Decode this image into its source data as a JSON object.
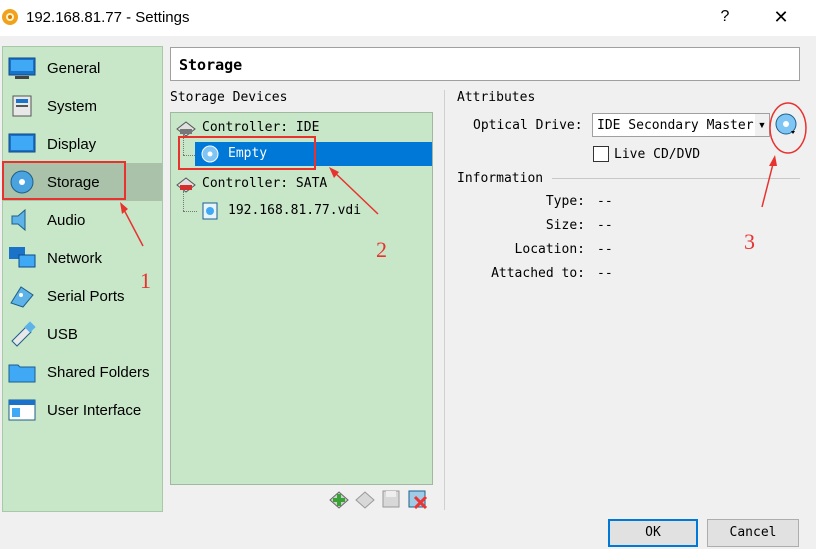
{
  "window": {
    "title": "192.168.81.77 - Settings",
    "help_glyph": "?",
    "close_glyph": "✕"
  },
  "sidebar": {
    "items": [
      {
        "label": "General",
        "icon": "general-icon"
      },
      {
        "label": "System",
        "icon": "system-icon"
      },
      {
        "label": "Display",
        "icon": "display-icon"
      },
      {
        "label": "Storage",
        "icon": "storage-icon",
        "selected": true
      },
      {
        "label": "Audio",
        "icon": "audio-icon"
      },
      {
        "label": "Network",
        "icon": "network-icon"
      },
      {
        "label": "Serial Ports",
        "icon": "serial-ports-icon"
      },
      {
        "label": "USB",
        "icon": "usb-icon"
      },
      {
        "label": "Shared Folders",
        "icon": "shared-folders-icon"
      },
      {
        "label": "User Interface",
        "icon": "user-interface-icon"
      }
    ]
  },
  "page": {
    "heading": "Storage"
  },
  "storage_devices": {
    "label": "Storage Devices",
    "tree": [
      {
        "label": "Controller: IDE",
        "type": "controller"
      },
      {
        "label": "Empty",
        "type": "optical",
        "selected": true
      },
      {
        "label": "Controller: SATA",
        "type": "controller"
      },
      {
        "label": "192.168.81.77.vdi",
        "type": "disk"
      }
    ],
    "toolbar": [
      "add-attachment-icon",
      "remove-controller-icon",
      "floppy-icon",
      "remove-attachment-icon"
    ]
  },
  "attributes": {
    "label": "Attributes",
    "optical_drive_label": "Optical Drive:",
    "optical_drive_value": "IDE Secondary Master",
    "live_cd_label": "Live CD/DVD",
    "live_cd_checked": false
  },
  "information": {
    "label": "Information",
    "rows": [
      {
        "key": "Type:",
        "value": "--"
      },
      {
        "key": "Size:",
        "value": "--"
      },
      {
        "key": "Location:",
        "value": "--"
      },
      {
        "key": "Attached to:",
        "value": "--"
      }
    ]
  },
  "buttons": {
    "ok": "OK",
    "cancel": "Cancel"
  },
  "annotations": {
    "one": "1",
    "two": "2",
    "three": "3",
    "color": "#e8322e"
  },
  "colors": {
    "sidebar_bg": "#c8e6c8",
    "selection": "#0078d7"
  }
}
